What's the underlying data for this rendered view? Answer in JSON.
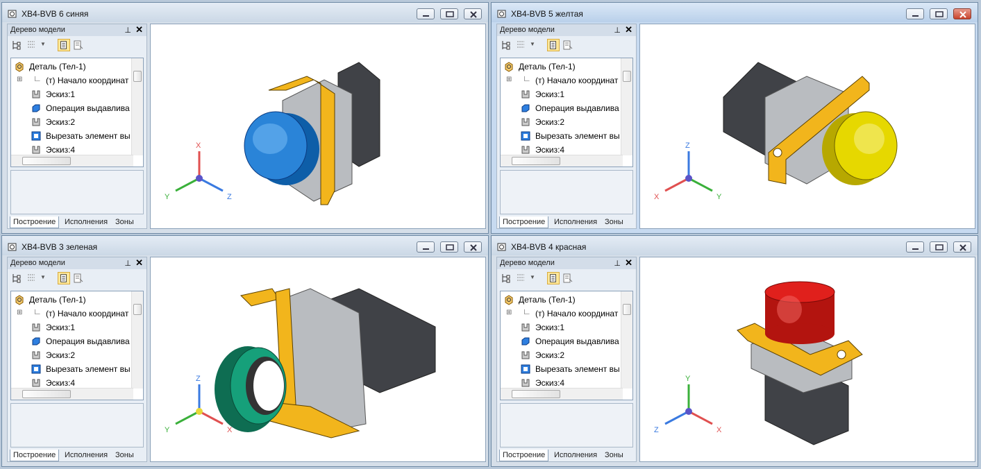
{
  "windows": [
    {
      "title": "XB4-BVB 6 синяя",
      "accent": "#2a84d8",
      "axes": [
        "X",
        "Y",
        "Z"
      ]
    },
    {
      "title": "XB4-BVB 5 желтая",
      "accent": "#e6d800",
      "axes": [
        "Z",
        "X",
        "Y"
      ]
    },
    {
      "title": "XB4-BVB 3 зеленая",
      "accent": "#16a07a",
      "axes": [
        "Z",
        "Y",
        "X"
      ]
    },
    {
      "title": "XB4-BVB 4 красная",
      "accent": "#e0201c",
      "axes": [
        "Y",
        "Z",
        "X"
      ]
    }
  ],
  "panel": {
    "title": "Дерево модели",
    "pin": "⊥",
    "close": "✕",
    "tree": [
      {
        "label": "Деталь (Тел-1)",
        "icon": "part-icon"
      },
      {
        "label": "(т) Начало координат",
        "icon": "origin-icon"
      },
      {
        "label": "Эскиз:1",
        "icon": "sketch-icon"
      },
      {
        "label": "Операция выдавлива",
        "icon": "extrude-icon"
      },
      {
        "label": "Эскиз:2",
        "icon": "sketch-icon"
      },
      {
        "label": "Вырезать элемент вы",
        "icon": "cut-icon"
      },
      {
        "label": "Эскиз:4",
        "icon": "sketch-icon"
      }
    ],
    "tabs": [
      "Построение",
      "Исполнения",
      "Зоны"
    ]
  },
  "colors": {
    "gold": "#f2b51c",
    "gray": "#b9bcc0",
    "dark": "#404247",
    "x_axis": "#e05050",
    "y_axis": "#3ab03a",
    "z_axis": "#3a7ae0"
  }
}
